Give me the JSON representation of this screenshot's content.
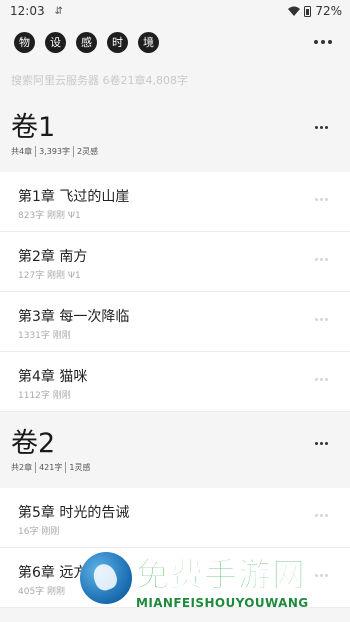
{
  "status_bar": {
    "time": "12:03",
    "usb_icon": "usb-icon",
    "battery": "72%"
  },
  "toolbar": {
    "chips": [
      "物",
      "设",
      "感",
      "时",
      "境"
    ],
    "more_icon": "more-horizontal-icon"
  },
  "search": {
    "placeholder": "搜索阿里云服务器 6卷21章4,808字"
  },
  "volumes": [
    {
      "title": "卷1",
      "stats": [
        "共4章",
        "3,393字",
        "2灵感"
      ],
      "chapters": [
        {
          "title": "第1章 飞过的山崖",
          "meta": "823字 刚刚 Ψ1"
        },
        {
          "title": "第2章 南方",
          "meta": "127字 刚刚 Ψ1"
        },
        {
          "title": "第3章 每一次降临",
          "meta": "1331字 刚刚"
        },
        {
          "title": "第4章 猫咪",
          "meta": "1112字 刚刚"
        }
      ]
    },
    {
      "title": "卷2",
      "stats": [
        "共2章",
        "421字",
        "1灵感"
      ],
      "chapters": [
        {
          "title": "第5章 时光的告诫",
          "meta": "16字 刚刚"
        },
        {
          "title": "第6章 远方的话语",
          "meta": "405字 刚刚"
        }
      ]
    }
  ],
  "watermark": {
    "title": "免费手游网",
    "subtitle": "MIANFEISHOUYOUWANG"
  }
}
